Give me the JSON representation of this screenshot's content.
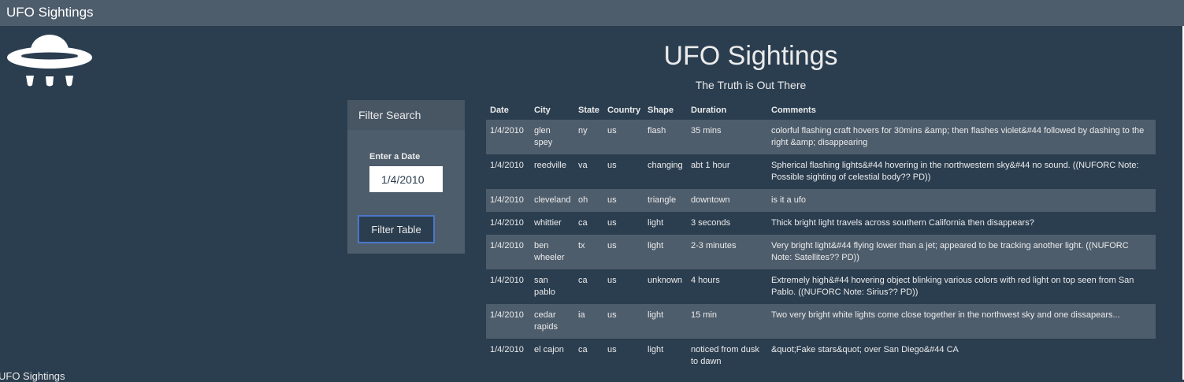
{
  "navbar": {
    "brand": "UFO Sightings"
  },
  "logo": {
    "icon": "ufo-icon"
  },
  "hero": {
    "title": "UFO Sightings",
    "subtitle": "The Truth is Out There"
  },
  "filter": {
    "heading": "Filter Search",
    "date_label": "Enter a Date",
    "date_value": "1/4/2010",
    "button_label": "Filter Table"
  },
  "table": {
    "headers": [
      "Date",
      "City",
      "State",
      "Country",
      "Shape",
      "Duration",
      "Comments"
    ],
    "rows": [
      [
        "1/4/2010",
        "glen spey",
        "ny",
        "us",
        "flash",
        "35 mins",
        "colorful flashing craft hovers for 30mins &amp; then flashes violet&#44 followed by dashing to the right &amp; disappearing"
      ],
      [
        "1/4/2010",
        "reedville",
        "va",
        "us",
        "changing",
        "abt 1 hour",
        "Spherical flashing lights&#44 hovering in the northwestern sky&#44 no sound. ((NUFORC Note: Possible sighting of celestial body?? PD))"
      ],
      [
        "1/4/2010",
        "cleveland",
        "oh",
        "us",
        "triangle",
        "downtown",
        "is it a ufo"
      ],
      [
        "1/4/2010",
        "whittier",
        "ca",
        "us",
        "light",
        "3 seconds",
        "Thick bright light travels across southern California then disappears?"
      ],
      [
        "1/4/2010",
        "ben wheeler",
        "tx",
        "us",
        "light",
        "2-3 minutes",
        "Very bright light&#44 flying lower than a jet; appeared to be tracking another light. ((NUFORC Note: Satellites?? PD))"
      ],
      [
        "1/4/2010",
        "san pablo",
        "ca",
        "us",
        "unknown",
        "4 hours",
        "Extremely high&#44 hovering object blinking various colors with red light on top seen from San Pablo. ((NUFORC Note: Sirius?? PD))"
      ],
      [
        "1/4/2010",
        "cedar rapids",
        "ia",
        "us",
        "light",
        "15 min",
        "Two very bright white lights come close together in the northwest sky and one dissapears..."
      ],
      [
        "1/4/2010",
        "el cajon",
        "ca",
        "us",
        "light",
        "noticed from dusk to dawn",
        "&quot;Fake stars&quot; over San Diego&#44 CA"
      ]
    ]
  },
  "footer": {
    "text": "UFO Sightings"
  }
}
